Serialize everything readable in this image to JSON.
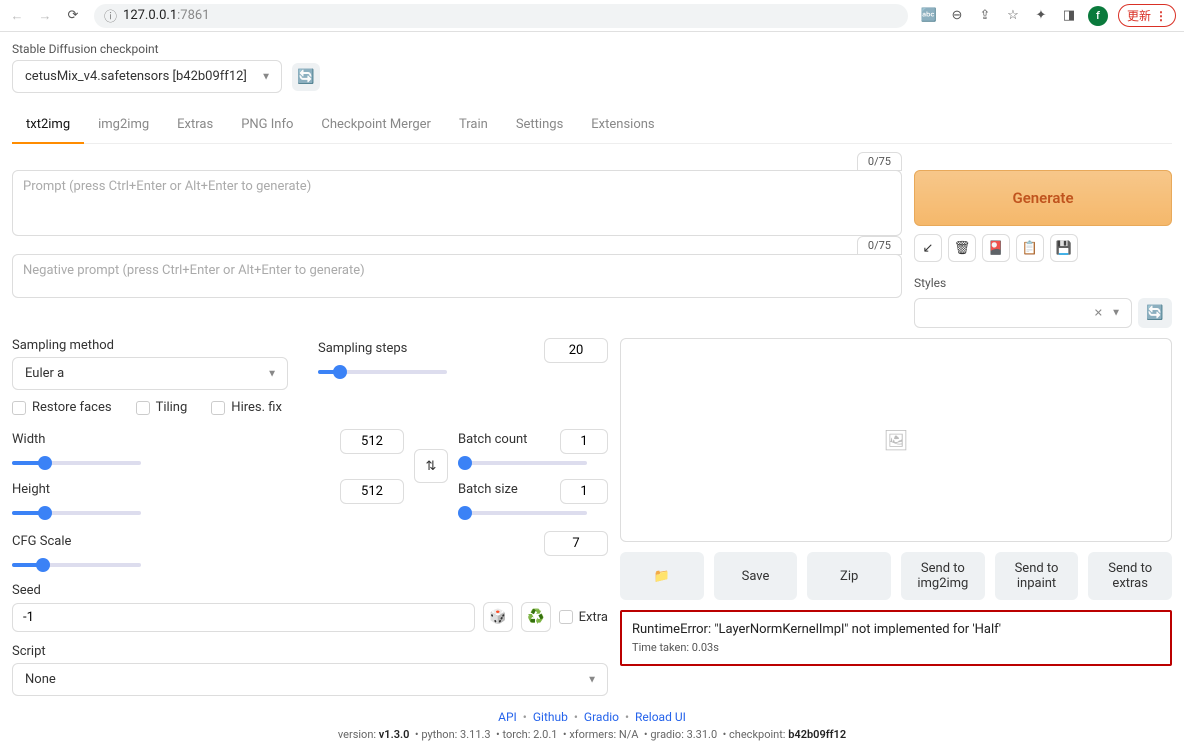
{
  "browser": {
    "url_host": "127.0.0.1",
    "url_port": ":7861",
    "avatar_letter": "f",
    "update_label": "更新"
  },
  "checkpoint": {
    "label": "Stable Diffusion checkpoint",
    "value": "cetusMix_v4.safetensors [b42b09ff12]"
  },
  "tabs": [
    "txt2img",
    "img2img",
    "Extras",
    "PNG Info",
    "Checkpoint Merger",
    "Train",
    "Settings",
    "Extensions"
  ],
  "prompt": {
    "pos_placeholder": "Prompt (press Ctrl+Enter or Alt+Enter to generate)",
    "neg_placeholder": "Negative prompt (press Ctrl+Enter or Alt+Enter to generate)",
    "pos_token": "0/75",
    "neg_token": "0/75"
  },
  "right": {
    "generate": "Generate",
    "styles_label": "Styles"
  },
  "sampling": {
    "method_label": "Sampling method",
    "method_value": "Euler a",
    "steps_label": "Sampling steps",
    "steps_value": "20"
  },
  "checks": {
    "restore": "Restore faces",
    "tiling": "Tiling",
    "hires": "Hires. fix"
  },
  "dims": {
    "width_label": "Width",
    "width_value": "512",
    "height_label": "Height",
    "height_value": "512",
    "batch_count_label": "Batch count",
    "batch_count_value": "1",
    "batch_size_label": "Batch size",
    "batch_size_value": "1"
  },
  "cfg": {
    "label": "CFG Scale",
    "value": "7"
  },
  "seed": {
    "label": "Seed",
    "value": "-1",
    "extra": "Extra"
  },
  "script": {
    "label": "Script",
    "value": "None"
  },
  "actions": {
    "save": "Save",
    "zip": "Zip",
    "send_img2img": "Send to img2img",
    "send_inpaint": "Send to inpaint",
    "send_extras": "Send to extras"
  },
  "error": {
    "msg": "RuntimeError: \"LayerNormKernelImpl\" not implemented for 'Half'",
    "time": "Time taken: 0.03s"
  },
  "footer": {
    "links": [
      "API",
      "Github",
      "Gradio",
      "Reload UI"
    ],
    "version_prefix": "version: ",
    "version": "v1.3.0",
    "python": "python: 3.11.3",
    "torch": "torch: 2.0.1",
    "xformers": "xformers: N/A",
    "gradio": "gradio: 3.31.0",
    "checkpoint_prefix": "checkpoint: ",
    "checkpoint_hash": "b42b09ff12"
  }
}
